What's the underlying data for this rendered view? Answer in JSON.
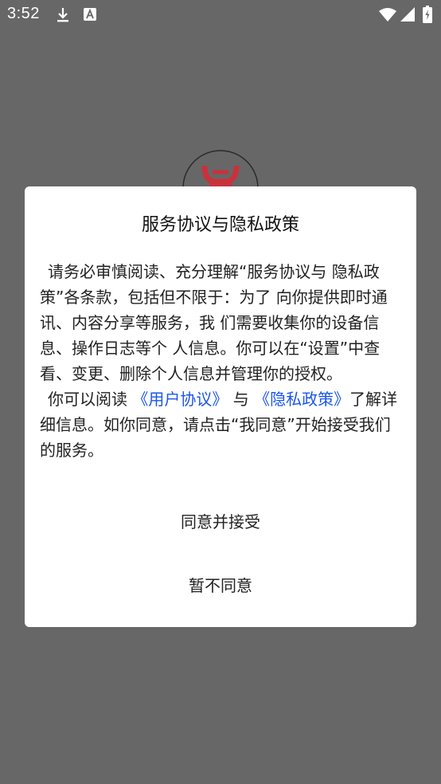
{
  "status_bar": {
    "time": "3:52",
    "icons": [
      "download-icon",
      "a-box-icon",
      "wifi-icon",
      "signal-icon",
      "battery-icon"
    ]
  },
  "dialog": {
    "title": "服务协议与隐私政策",
    "para1": "请务必审慎阅读、充分理解“服务协议与 隐私政策”各条款，包括但不限于：为了 向你提供即时通讯、内容分享等服务，我 们需要收集你的设备信息、操作日志等个 人信息。你可以在“设置”中查看、变更、删除个人信息并管理你的授权。",
    "para2_prefix": "你可以阅读 ",
    "user_agreement_link": "《用户协议》",
    "para2_and": " 与 ",
    "privacy_policy_link": "《隐私政策》",
    "para2_suffix": "了解详细信息。如你同意，请点击“我同意”开始接受我们的服务。",
    "agree_button": "同意并接受",
    "disagree_button": "暂不同意"
  },
  "colors": {
    "overlay_background": "#676767",
    "dialog_background": "#ffffff",
    "link": "#1a56e8",
    "logo_accent": "#c8323c"
  }
}
